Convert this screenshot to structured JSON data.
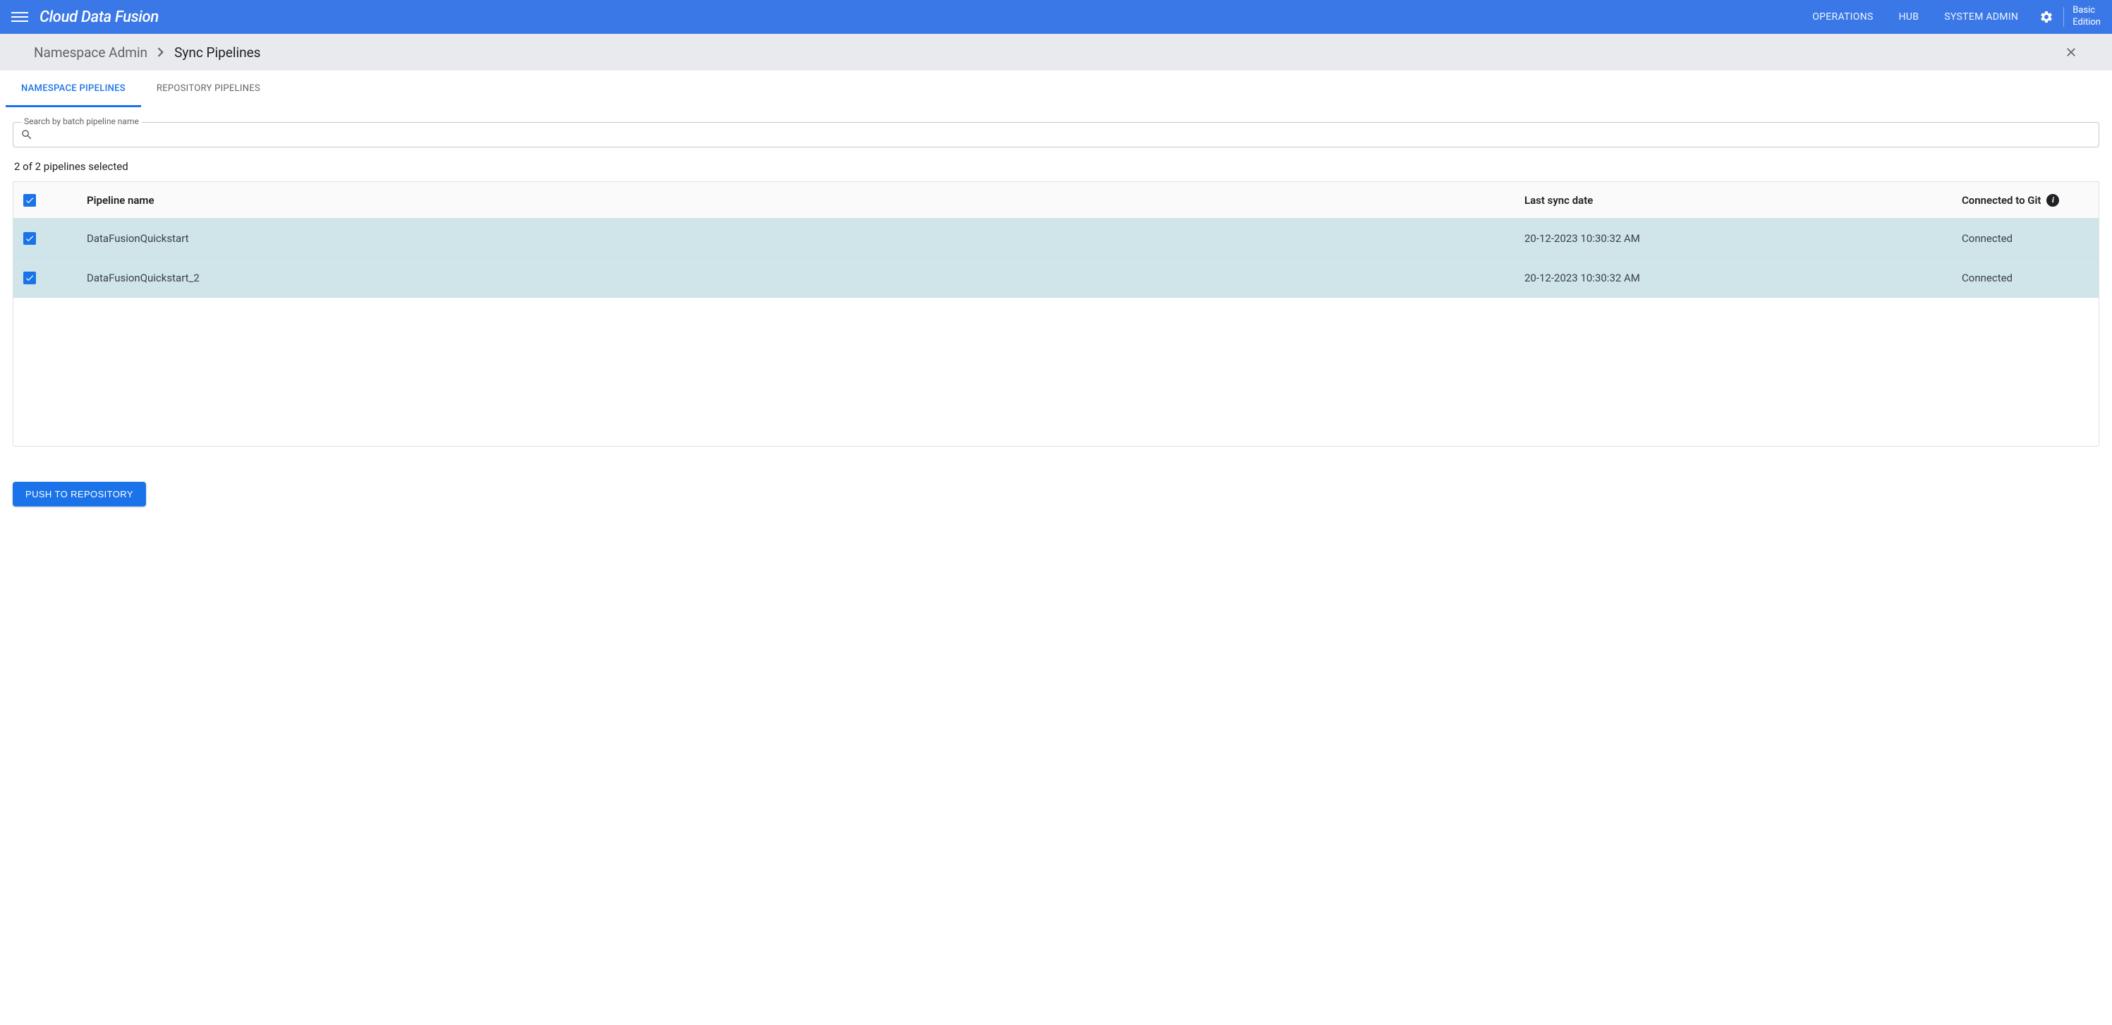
{
  "header": {
    "product_name": "Cloud Data Fusion",
    "nav": {
      "operations": "OPERATIONS",
      "hub": "HUB",
      "system_admin": "SYSTEM ADMIN"
    },
    "edition": "Basic\nEdition"
  },
  "breadcrumb": {
    "root": "Namespace Admin",
    "current": "Sync Pipelines"
  },
  "tabs": {
    "namespace": "NAMESPACE PIPELINES",
    "repository": "REPOSITORY PIPELINES"
  },
  "search": {
    "label": "Search by batch pipeline name",
    "value": ""
  },
  "selection_text": "2 of 2 pipelines selected",
  "table": {
    "headers": {
      "name": "Pipeline name",
      "date": "Last sync date",
      "git": "Connected to Git"
    },
    "rows": [
      {
        "name": "DataFusionQuickstart",
        "date": "20-12-2023 10:30:32 AM",
        "git": "Connected"
      },
      {
        "name": "DataFusionQuickstart_2",
        "date": "20-12-2023 10:30:32 AM",
        "git": "Connected"
      }
    ]
  },
  "push_button": "PUSH TO REPOSITORY"
}
